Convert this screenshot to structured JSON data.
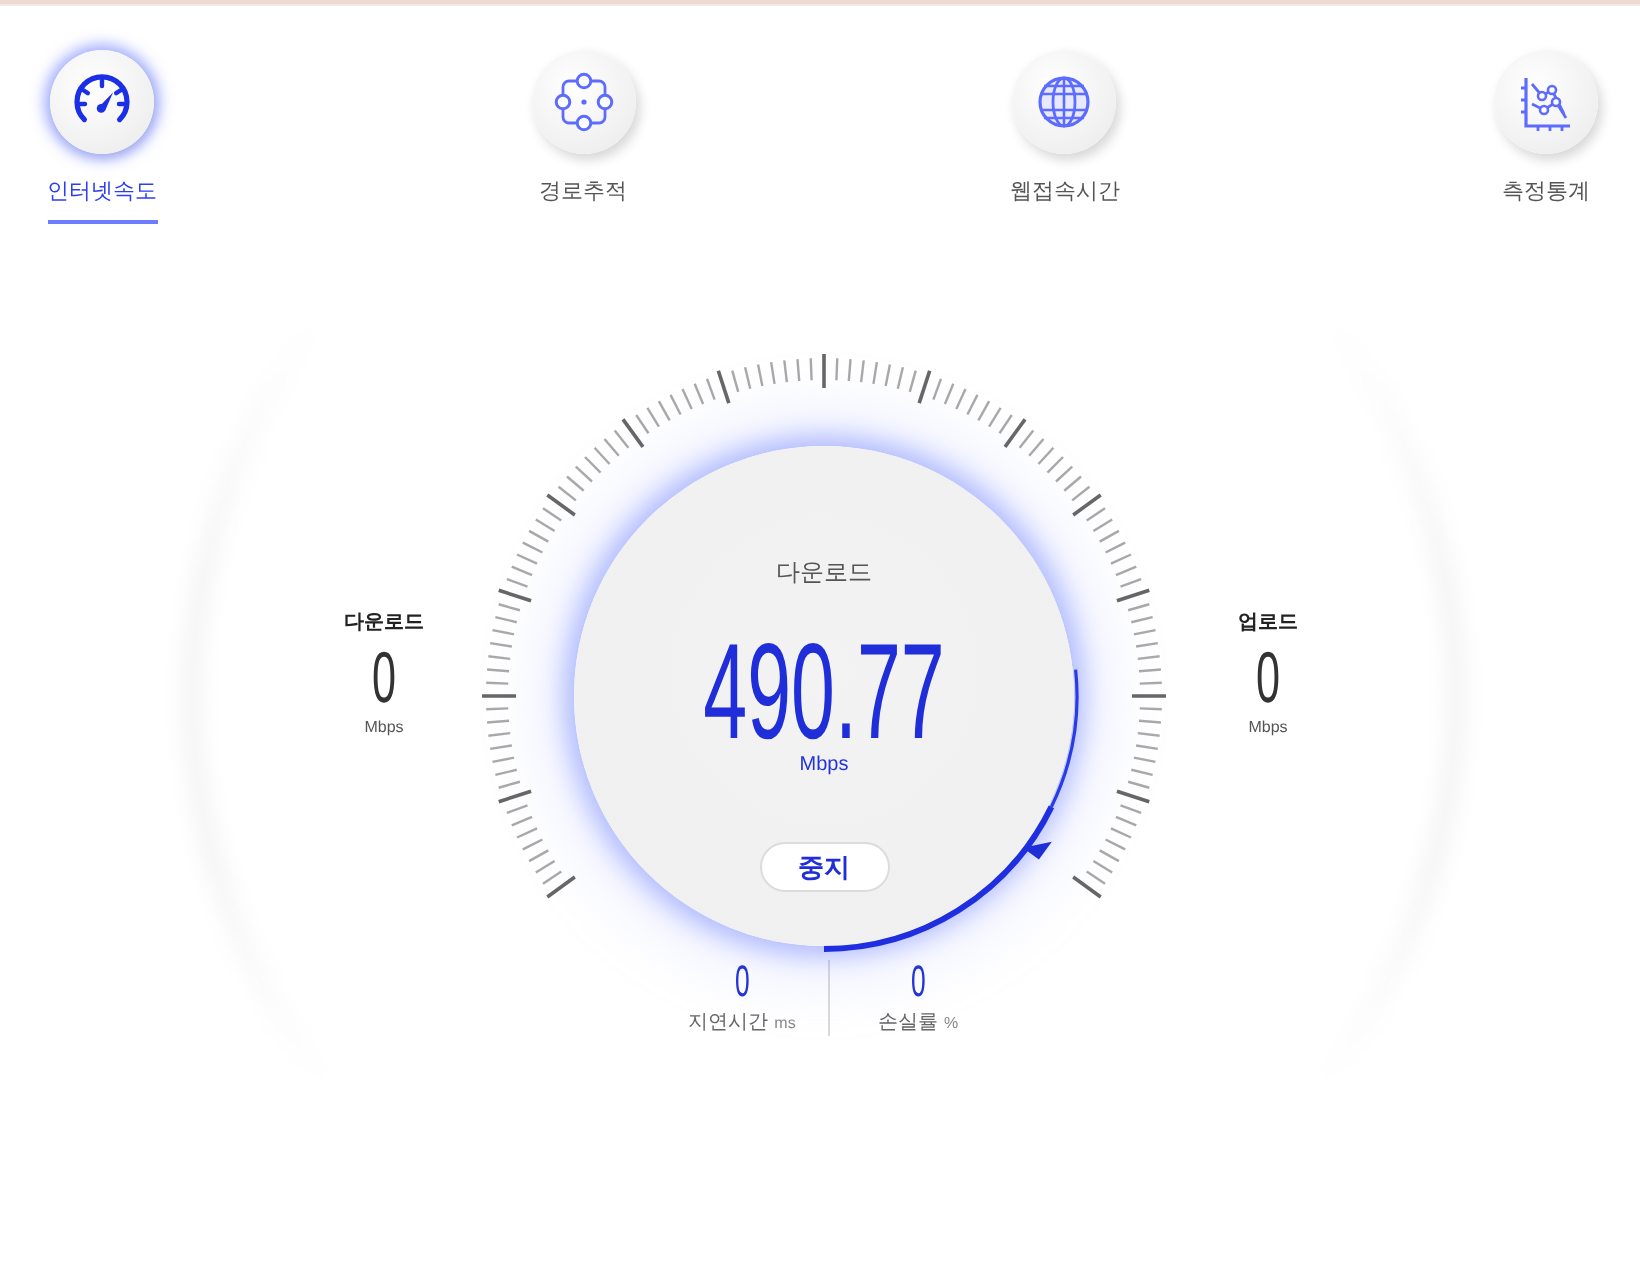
{
  "tabs": [
    {
      "label": "인터넷속도",
      "selected": true
    },
    {
      "label": "경로추적",
      "selected": false
    },
    {
      "label": "웹접속시간",
      "selected": false
    },
    {
      "label": "측정통계",
      "selected": false
    }
  ],
  "download": {
    "label": "다운로드",
    "value": "0",
    "unit": "Mbps"
  },
  "gauge": {
    "label": "다운로드",
    "value": "490.77",
    "unit": "Mbps",
    "button": "중지"
  },
  "upload": {
    "label": "업로드",
    "value": "0",
    "unit": "Mbps"
  },
  "metrics": [
    {
      "value": "0",
      "label": "지연시간",
      "unit": "ms"
    },
    {
      "value": "0",
      "label": "손실률",
      "unit": "%"
    }
  ]
}
